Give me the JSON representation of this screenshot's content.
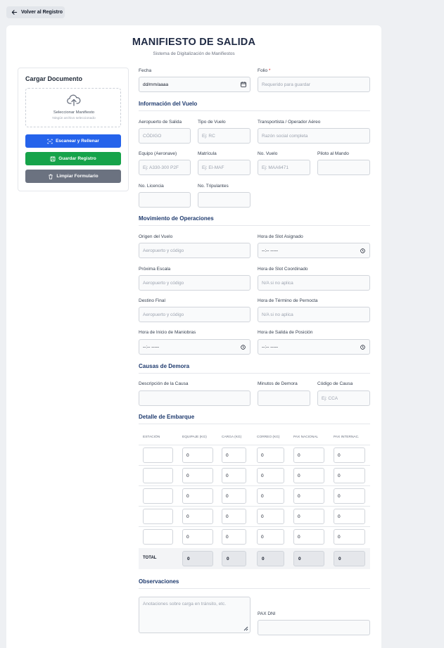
{
  "nav": {
    "back_label": "Volver al Registro"
  },
  "header": {
    "title": "MANIFIESTO DE SALIDA",
    "subtitle": "Sistema de Digitalización de Manifiestos"
  },
  "sidebar": {
    "title": "Cargar Documento",
    "dropzone_main": "Seleccionar Manifiesto",
    "dropzone_sub": "Ningún archivo seleccionado",
    "scan_label": "Escanear y Rellenar",
    "save_label": "Guardar Registro",
    "clear_label": "Limpiar Formulario",
    "colors": {
      "scan": "#2563eb",
      "save": "#16a34a",
      "clear": "#6b7280"
    }
  },
  "top": {
    "fecha_label": "Fecha",
    "fecha_value": "dd/mm/aaaa",
    "folio_label": "Folio",
    "folio_required": "*",
    "folio_placeholder": "Requerido para guardar"
  },
  "vuelo": {
    "section_title": "Información del Vuelo",
    "aeropuerto_label": "Aeropuerto de Salida",
    "aeropuerto_ph": "CÓDIGO",
    "tipo_label": "Tipo de Vuelo",
    "tipo_ph": "Ej: RC",
    "transportista_label": "Transportista / Operador Aéreo",
    "transportista_ph": "Razón social completa",
    "equipo_label": "Equipo (Aeronave)",
    "equipo_ph": "Ej: A330-300 P2F",
    "matricula_label": "Matrícula",
    "matricula_ph": "Ej: EI-MAF",
    "novuelo_label": "No. Vuelo",
    "novuelo_ph": "Ej: MAA6471",
    "piloto_label": "Piloto al Mando",
    "licencia_label": "No. Licencia",
    "tripulantes_label": "No. Tripulantes"
  },
  "operaciones": {
    "section_title": "Movimiento de Operaciones",
    "origen_label": "Origen del Vuelo",
    "origen_ph": "Aeropuerto y código",
    "slot_asig_label": "Hora de Slot Asignado",
    "time_ph": "--:-- -----",
    "escala_label": "Próxima Escala",
    "escala_ph": "Aeropuerto y código",
    "slot_coord_label": "Hora de Slot Coordinado",
    "slot_coord_ph": "N/A si no aplica",
    "destino_label": "Destino Final",
    "destino_ph": "Aeropuerto y código",
    "pernocta_label": "Hora de Término de Pernocta",
    "pernocta_ph": "N/A si no aplica",
    "maniobras_label": "Hora de Inicio de Maniobras",
    "posicion_label": "Hora de Salida de Posición"
  },
  "demora": {
    "section_title": "Causas de Demora",
    "descripcion_label": "Descripción de la Causa",
    "minutos_label": "Minutos de Demora",
    "codigo_label": "Código de Causa",
    "codigo_ph": "Ej: CCA"
  },
  "embarque": {
    "section_title": "Detalle de Embarque",
    "columns": [
      "ESTACIÓN",
      "EQUIPAJE (KG)",
      "CARGA (KG)",
      "CORREO (KG)",
      "PAX NACIONAL",
      "PAX INTERNAC."
    ],
    "rows": [
      [
        "",
        "0",
        "0",
        "0",
        "0",
        "0"
      ],
      [
        "",
        "0",
        "0",
        "0",
        "0",
        "0"
      ],
      [
        "",
        "0",
        "0",
        "0",
        "0",
        "0"
      ],
      [
        "",
        "0",
        "0",
        "0",
        "0",
        "0"
      ],
      [
        "",
        "0",
        "0",
        "0",
        "0",
        "0"
      ]
    ],
    "total_label": "TOTAL",
    "totals": [
      "0",
      "0",
      "0",
      "0",
      "0"
    ]
  },
  "observaciones": {
    "section_title": "Observaciones",
    "placeholder": "Anotaciones sobre carga en tránsito, etc.",
    "paxdni_label": "PAX DNI"
  }
}
